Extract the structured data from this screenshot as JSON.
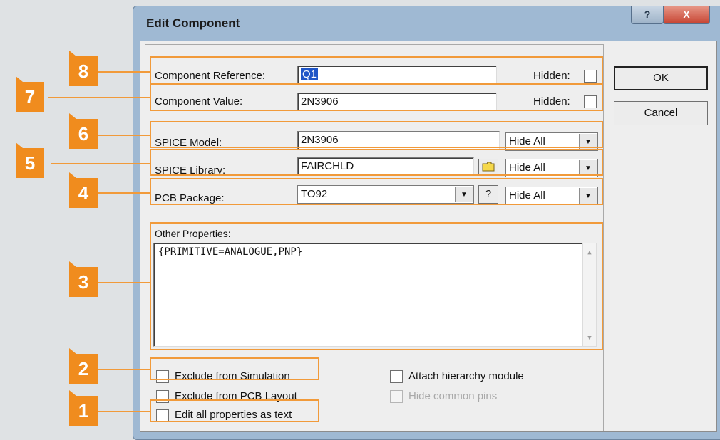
{
  "dialog": {
    "title": "Edit Component",
    "help_button": "?",
    "close_button": "X"
  },
  "fields": {
    "reference": {
      "label": "Component Reference:",
      "value": "Q1",
      "hidden_label": "Hidden:"
    },
    "value": {
      "label": "Component Value:",
      "value": "2N3906",
      "hidden_label": "Hidden:"
    },
    "spice_model": {
      "label": "SPICE Model:",
      "value": "2N3906",
      "visibility": "Hide All"
    },
    "spice_library": {
      "label": "SPICE Library:",
      "value": "FAIRCHLD",
      "visibility": "Hide All"
    },
    "pcb_package": {
      "label": "PCB Package:",
      "value": "TO92",
      "help": "?",
      "visibility": "Hide All"
    },
    "other_properties": {
      "label": "Other Properties:",
      "value": "{PRIMITIVE=ANALOGUE,PNP}"
    }
  },
  "checkboxes": {
    "exclude_simulation": "Exclude from Simulation",
    "exclude_pcb": "Exclude from PCB Layout",
    "edit_as_text": "Edit all properties as text",
    "attach_hierarchy": "Attach hierarchy module",
    "hide_common_pins": "Hide common pins"
  },
  "buttons": {
    "ok": "OK",
    "cancel": "Cancel"
  },
  "callouts": [
    "8",
    "7",
    "6",
    "5",
    "4",
    "3",
    "2",
    "1"
  ],
  "colors": {
    "callout": "#f08c1e",
    "title_bar": "#9fb9d3",
    "dialog_face": "#eeeeee"
  }
}
